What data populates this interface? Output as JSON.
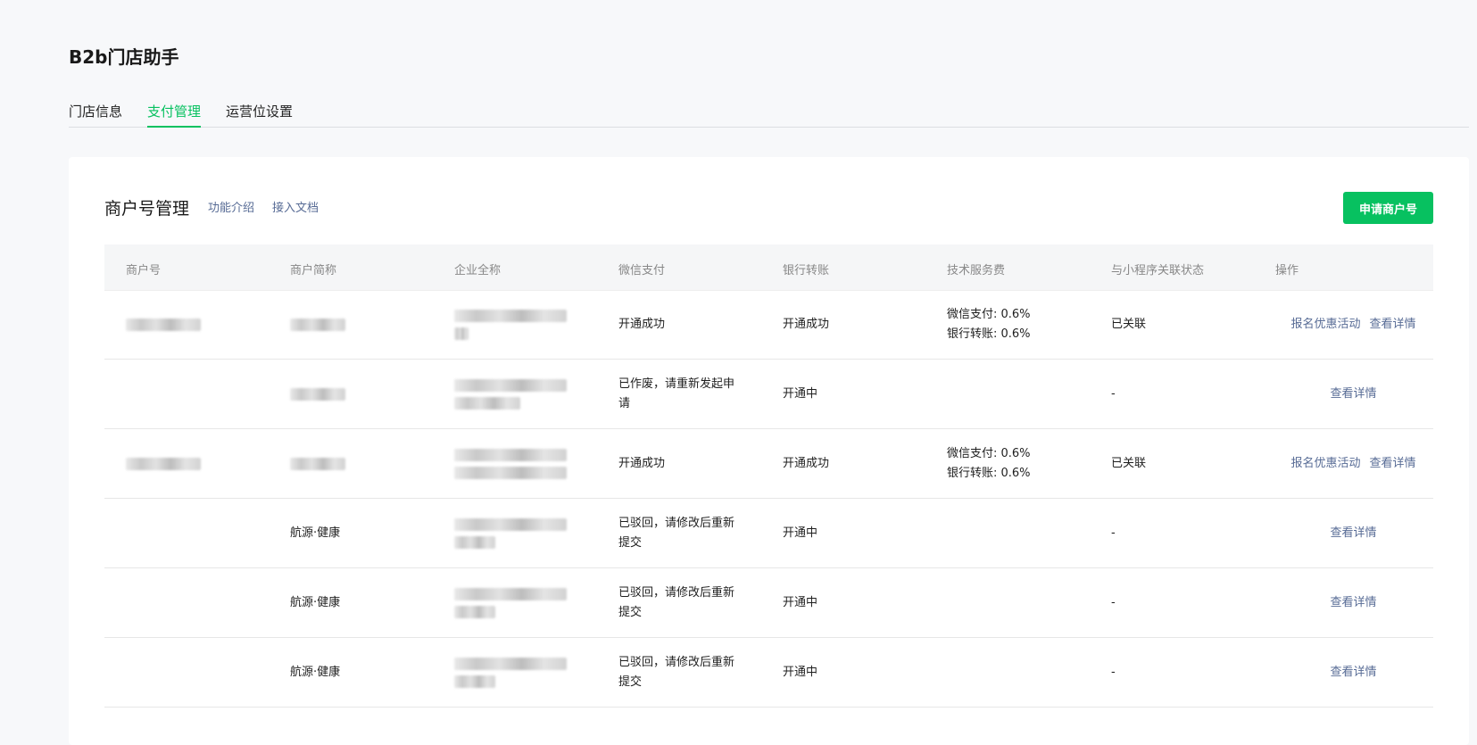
{
  "app": {
    "title": "B2b门店助手"
  },
  "tabs": [
    {
      "label": "门店信息"
    },
    {
      "label": "支付管理"
    },
    {
      "label": "运营位设置"
    }
  ],
  "section": {
    "title": "商户号管理",
    "links": {
      "intro": "功能介绍",
      "docs": "接入文档"
    },
    "apply_button": "申请商户号"
  },
  "table": {
    "headers": [
      "商户号",
      "商户简称",
      "企业全称",
      "微信支付",
      "银行转账",
      "技术服务费",
      "与小程序关联状态",
      "操作"
    ],
    "rows": [
      {
        "merchant_no": "",
        "short_name": "",
        "full_name": "",
        "wechat_pay": "开通成功",
        "bank_transfer": "开通成功",
        "fee_wechat": "微信支付: 0.6%",
        "fee_bank": "银行转账: 0.6%",
        "link_status": "已关联",
        "actions": [
          "报名优惠活动",
          "查看详情"
        ]
      },
      {
        "merchant_no": "",
        "short_name": "",
        "full_name": "",
        "wechat_pay": "已作废，请重新发起申请",
        "bank_transfer": "开通中",
        "fee_wechat": "",
        "fee_bank": "",
        "link_status": "-",
        "actions": [
          "查看详情"
        ]
      },
      {
        "merchant_no": "",
        "short_name": "",
        "full_name": "",
        "wechat_pay": "开通成功",
        "bank_transfer": "开通成功",
        "fee_wechat": "微信支付: 0.6%",
        "fee_bank": "银行转账: 0.6%",
        "link_status": "已关联",
        "actions": [
          "报名优惠活动",
          "查看详情"
        ]
      },
      {
        "merchant_no": "",
        "short_name": "航源·健康",
        "full_name": "",
        "wechat_pay": "已驳回，请修改后重新提交",
        "bank_transfer": "开通中",
        "fee_wechat": "",
        "fee_bank": "",
        "link_status": "-",
        "actions": [
          "查看详情"
        ]
      },
      {
        "merchant_no": "",
        "short_name": "航源·健康",
        "full_name": "",
        "wechat_pay": "已驳回，请修改后重新提交",
        "bank_transfer": "开通中",
        "fee_wechat": "",
        "fee_bank": "",
        "link_status": "-",
        "actions": [
          "查看详情"
        ]
      },
      {
        "merchant_no": "",
        "short_name": "航源·健康",
        "full_name": "",
        "wechat_pay": "已驳回，请修改后重新提交",
        "bank_transfer": "开通中",
        "fee_wechat": "",
        "fee_bank": "",
        "link_status": "-",
        "actions": [
          "查看详情"
        ]
      }
    ]
  },
  "colors": {
    "accent": "#07c160",
    "link": "#576b95",
    "background": "#f7f8fa"
  }
}
